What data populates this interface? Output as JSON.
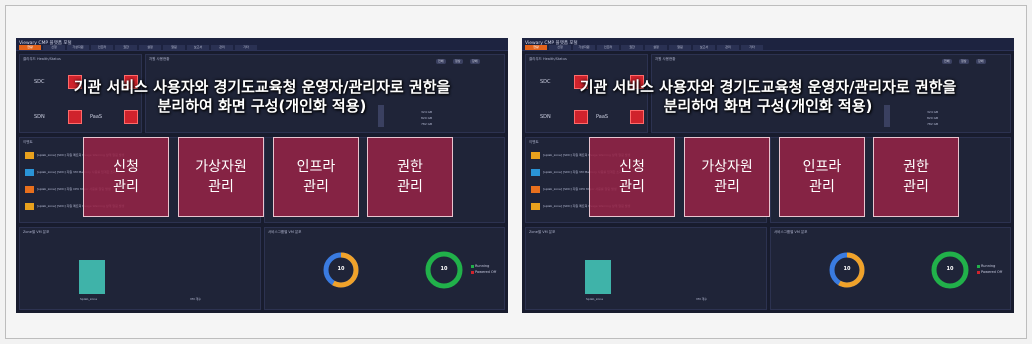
{
  "panels": [
    {
      "id": "left",
      "app_title": "Viewary CMP 플랫폼 포털",
      "tabs": [
        "현황",
        "신청",
        "가상자원",
        "인프라",
        "권한",
        "설정",
        "알림",
        "보고서",
        "관리",
        "기타"
      ],
      "health_card_title": "클라우드 Health/Status",
      "vm_card_title": "자원 사용현황",
      "sdc_label": "SDC",
      "sdn_label": "SDN",
      "paas_label": "PaaS",
      "event_card_title": "이벤트",
      "zone_vm_title": "Zone별 VM 분포",
      "service_vm_title": "서비스그룹별 VM 분포",
      "zone_bar_label": "Splab_zone",
      "zone_bottom_label": "VM 개수",
      "ring1_value": "10",
      "ring2_value": "10",
      "legend_running": "Running",
      "legend_poweroff": "Powered Off",
      "events": [
        "[splab_zone] [SDC] 자원 메트릭 Usage Warning 상태 알림 발생",
        "[splab_zone] [SDC] 자원 VM Memory 사용률 임계값 초과",
        "[splab_zone] [SDC] 자원 CPU Major 사용률 알림 발생",
        "[splab_zone] [SDC] 자원 메트릭 Usage Warning 상태 알림 발생"
      ],
      "storage": [
        "324 GB",
        "820 GB",
        "782 GB"
      ]
    },
    {
      "id": "right",
      "app_title": "Viewary CMP 플랫폼 포털",
      "tabs": [
        "현황",
        "신청",
        "가상자원",
        "인프라",
        "권한",
        "설정",
        "알림",
        "보고서",
        "관리",
        "기타"
      ],
      "health_card_title": "클라우드 Health/Status",
      "vm_card_title": "자원 사용현황",
      "sdc_label": "SDC",
      "sdn_label": "SDN",
      "paas_label": "PaaS",
      "event_card_title": "이벤트",
      "zone_vm_title": "Zone별 VM 분포",
      "service_vm_title": "서비스그룹별 VM 분포",
      "zone_bar_label": "Splab_zone",
      "zone_bottom_label": "VM 개수",
      "ring1_value": "10",
      "ring2_value": "10",
      "legend_running": "Running",
      "legend_poweroff": "Powered Off",
      "events": [
        "[splab_zone] [SDC] 자원 메트릭 Usage Warning 상태 알림 발생",
        "[splab_zone] [SDC] 자원 VM Memory 사용률 임계값 초과",
        "[splab_zone] [SDC] 자원 CPU Major 사용률 알림 발생",
        "[splab_zone] [SDC] 자원 메트릭 Usage Warning 상태 알림 발생"
      ],
      "storage": [
        "324 GB",
        "820 GB",
        "782 GB"
      ]
    }
  ],
  "overlay": {
    "headline_line1": "기관 서비스 사용자와 경기도교육청 운영자/관리자로 권한을",
    "headline_line2": "분리하여 화면 구성(개인화 적용)",
    "boxes": [
      "신청\n관리",
      "가상자원\n관리",
      "인프라\n관리",
      "권한\n관리"
    ]
  },
  "colors": {
    "accent_orange": "#e2621b",
    "alert_red": "#d0232c",
    "overlay_magenta": "#962346",
    "ring_green": "#21b14a",
    "ring_orange": "#f0a22a",
    "ring_blue": "#3a7be0",
    "bar_teal": "#3fb3a9",
    "dashboard_bg": "#181c2e"
  }
}
